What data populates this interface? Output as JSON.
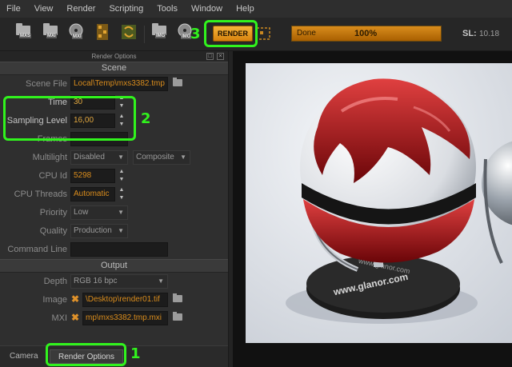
{
  "menu": [
    "File",
    "View",
    "Render",
    "Scripting",
    "Tools",
    "Window",
    "Help"
  ],
  "toolbar": {
    "buttons": [
      "MXS",
      "MXI",
      "MXI",
      "IMG",
      "IMG"
    ],
    "render_label": "RENDER",
    "progress_label": "Done",
    "progress_value": "100%",
    "progress_fraction": 1.0,
    "sl_label": "SL:",
    "sl_value": "10.18"
  },
  "panel": {
    "title": "Render Options",
    "scene_section": "Scene",
    "scene_file_label": "Scene File",
    "scene_file_value": "Local\\Temp\\mxs3382.tmp",
    "time_label": "Time",
    "time_value": "30",
    "sampling_label": "Sampling Level",
    "sampling_value": "16,00",
    "frames_label": "Frames",
    "multilight_label": "Multilight",
    "multilight_value": "Disabled",
    "multilight_mode": "Composite",
    "cpu_id_label": "CPU Id",
    "cpu_id_value": "5298",
    "cpu_threads_label": "CPU Threads",
    "cpu_threads_value": "Automatic",
    "priority_label": "Priority",
    "priority_value": "Low",
    "quality_label": "Quality",
    "quality_value": "Production",
    "command_line_label": "Command Line",
    "output_section": "Output",
    "depth_label": "Depth",
    "depth_value": "RGB 16 bpc",
    "image_label": "Image",
    "image_value": "\\Desktop\\render01.tif",
    "mxi_label": "MXI",
    "mxi_value": "mp\\mxs3382.tmp.mxi"
  },
  "tabs": [
    "Camera",
    "Render Options"
  ],
  "annotations": [
    "1",
    "2",
    "3"
  ],
  "viewport": {
    "logo_text_1": "www.glanor.com",
    "logo_text_2": "www.glanor.com"
  },
  "colors": {
    "accent": "#d98c1c",
    "highlight": "#31f31d"
  }
}
